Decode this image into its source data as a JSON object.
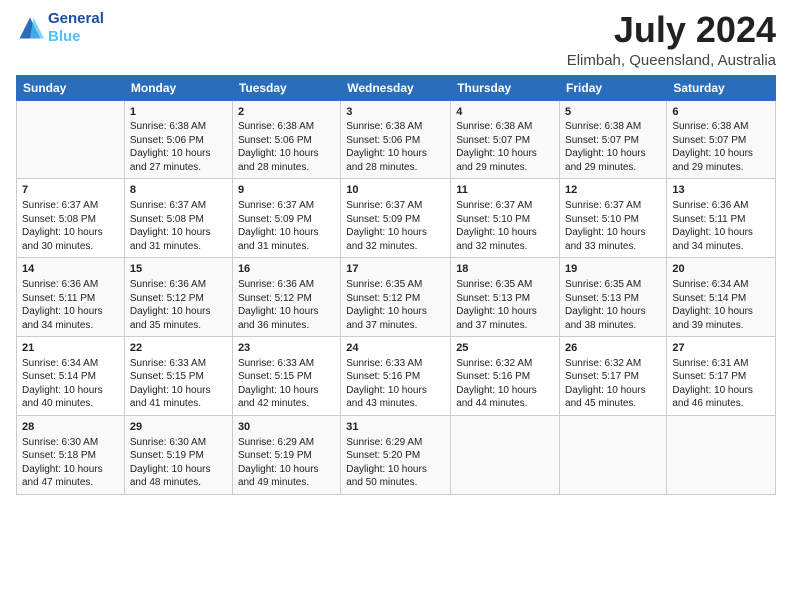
{
  "header": {
    "logo_line1": "General",
    "logo_line2": "Blue",
    "title": "July 2024",
    "subtitle": "Elimbah, Queensland, Australia"
  },
  "weekdays": [
    "Sunday",
    "Monday",
    "Tuesday",
    "Wednesday",
    "Thursday",
    "Friday",
    "Saturday"
  ],
  "weeks": [
    [
      {
        "day": "",
        "content": ""
      },
      {
        "day": "1",
        "content": "Sunrise: 6:38 AM\nSunset: 5:06 PM\nDaylight: 10 hours\nand 27 minutes."
      },
      {
        "day": "2",
        "content": "Sunrise: 6:38 AM\nSunset: 5:06 PM\nDaylight: 10 hours\nand 28 minutes."
      },
      {
        "day": "3",
        "content": "Sunrise: 6:38 AM\nSunset: 5:06 PM\nDaylight: 10 hours\nand 28 minutes."
      },
      {
        "day": "4",
        "content": "Sunrise: 6:38 AM\nSunset: 5:07 PM\nDaylight: 10 hours\nand 29 minutes."
      },
      {
        "day": "5",
        "content": "Sunrise: 6:38 AM\nSunset: 5:07 PM\nDaylight: 10 hours\nand 29 minutes."
      },
      {
        "day": "6",
        "content": "Sunrise: 6:38 AM\nSunset: 5:07 PM\nDaylight: 10 hours\nand 29 minutes."
      }
    ],
    [
      {
        "day": "7",
        "content": "Sunrise: 6:37 AM\nSunset: 5:08 PM\nDaylight: 10 hours\nand 30 minutes."
      },
      {
        "day": "8",
        "content": "Sunrise: 6:37 AM\nSunset: 5:08 PM\nDaylight: 10 hours\nand 31 minutes."
      },
      {
        "day": "9",
        "content": "Sunrise: 6:37 AM\nSunset: 5:09 PM\nDaylight: 10 hours\nand 31 minutes."
      },
      {
        "day": "10",
        "content": "Sunrise: 6:37 AM\nSunset: 5:09 PM\nDaylight: 10 hours\nand 32 minutes."
      },
      {
        "day": "11",
        "content": "Sunrise: 6:37 AM\nSunset: 5:10 PM\nDaylight: 10 hours\nand 32 minutes."
      },
      {
        "day": "12",
        "content": "Sunrise: 6:37 AM\nSunset: 5:10 PM\nDaylight: 10 hours\nand 33 minutes."
      },
      {
        "day": "13",
        "content": "Sunrise: 6:36 AM\nSunset: 5:11 PM\nDaylight: 10 hours\nand 34 minutes."
      }
    ],
    [
      {
        "day": "14",
        "content": "Sunrise: 6:36 AM\nSunset: 5:11 PM\nDaylight: 10 hours\nand 34 minutes."
      },
      {
        "day": "15",
        "content": "Sunrise: 6:36 AM\nSunset: 5:12 PM\nDaylight: 10 hours\nand 35 minutes."
      },
      {
        "day": "16",
        "content": "Sunrise: 6:36 AM\nSunset: 5:12 PM\nDaylight: 10 hours\nand 36 minutes."
      },
      {
        "day": "17",
        "content": "Sunrise: 6:35 AM\nSunset: 5:12 PM\nDaylight: 10 hours\nand 37 minutes."
      },
      {
        "day": "18",
        "content": "Sunrise: 6:35 AM\nSunset: 5:13 PM\nDaylight: 10 hours\nand 37 minutes."
      },
      {
        "day": "19",
        "content": "Sunrise: 6:35 AM\nSunset: 5:13 PM\nDaylight: 10 hours\nand 38 minutes."
      },
      {
        "day": "20",
        "content": "Sunrise: 6:34 AM\nSunset: 5:14 PM\nDaylight: 10 hours\nand 39 minutes."
      }
    ],
    [
      {
        "day": "21",
        "content": "Sunrise: 6:34 AM\nSunset: 5:14 PM\nDaylight: 10 hours\nand 40 minutes."
      },
      {
        "day": "22",
        "content": "Sunrise: 6:33 AM\nSunset: 5:15 PM\nDaylight: 10 hours\nand 41 minutes."
      },
      {
        "day": "23",
        "content": "Sunrise: 6:33 AM\nSunset: 5:15 PM\nDaylight: 10 hours\nand 42 minutes."
      },
      {
        "day": "24",
        "content": "Sunrise: 6:33 AM\nSunset: 5:16 PM\nDaylight: 10 hours\nand 43 minutes."
      },
      {
        "day": "25",
        "content": "Sunrise: 6:32 AM\nSunset: 5:16 PM\nDaylight: 10 hours\nand 44 minutes."
      },
      {
        "day": "26",
        "content": "Sunrise: 6:32 AM\nSunset: 5:17 PM\nDaylight: 10 hours\nand 45 minutes."
      },
      {
        "day": "27",
        "content": "Sunrise: 6:31 AM\nSunset: 5:17 PM\nDaylight: 10 hours\nand 46 minutes."
      }
    ],
    [
      {
        "day": "28",
        "content": "Sunrise: 6:30 AM\nSunset: 5:18 PM\nDaylight: 10 hours\nand 47 minutes."
      },
      {
        "day": "29",
        "content": "Sunrise: 6:30 AM\nSunset: 5:19 PM\nDaylight: 10 hours\nand 48 minutes."
      },
      {
        "day": "30",
        "content": "Sunrise: 6:29 AM\nSunset: 5:19 PM\nDaylight: 10 hours\nand 49 minutes."
      },
      {
        "day": "31",
        "content": "Sunrise: 6:29 AM\nSunset: 5:20 PM\nDaylight: 10 hours\nand 50 minutes."
      },
      {
        "day": "",
        "content": ""
      },
      {
        "day": "",
        "content": ""
      },
      {
        "day": "",
        "content": ""
      }
    ]
  ]
}
